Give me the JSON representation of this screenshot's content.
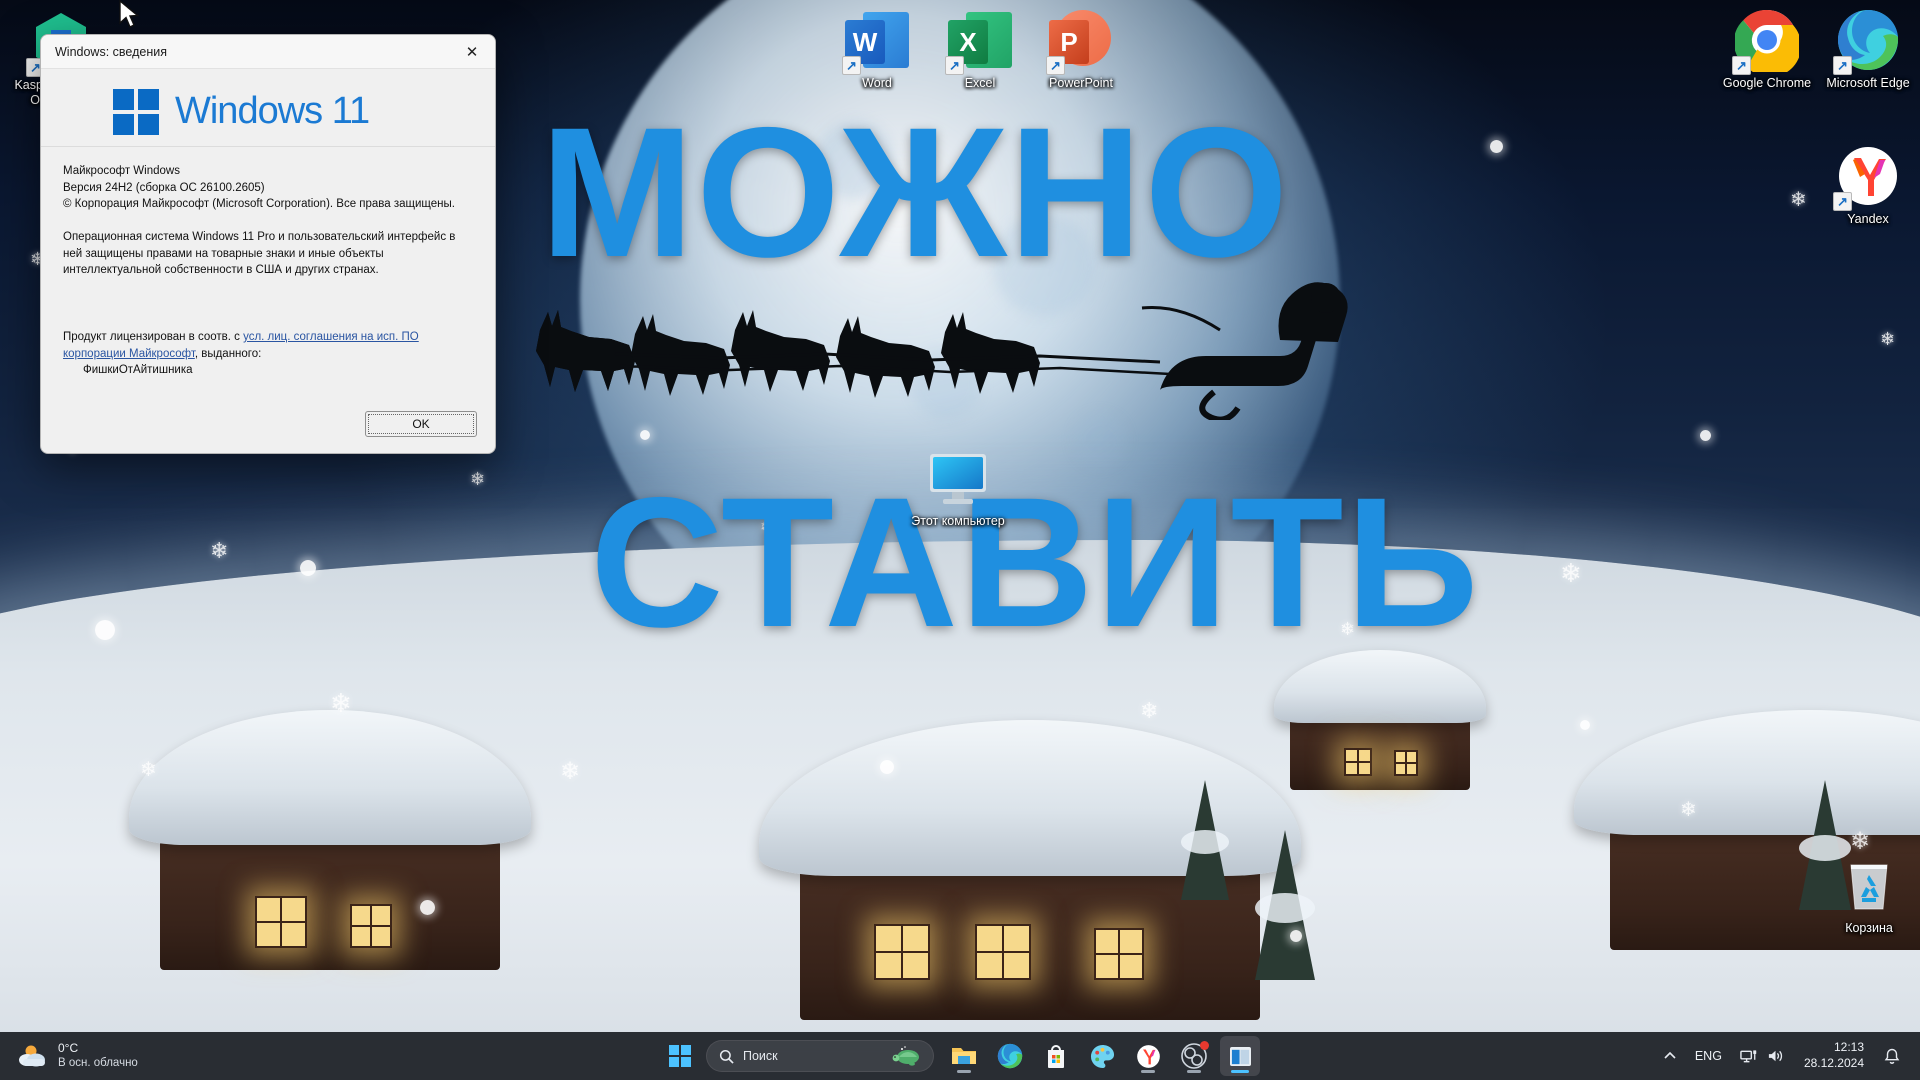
{
  "wallpaper": {
    "scene": "winter-night-village-moon",
    "overlay_text_line1": "МОЖНО",
    "overlay_text_line2": "СТАВИТЬ",
    "overlay_color": "#1f8fe0"
  },
  "dialog": {
    "title": "Windows: сведения",
    "close_label": "✕",
    "brand_name": "Windows 11",
    "line_product": "Майкрософт Windows",
    "line_version": "Версия 24H2 (сборка ОС 26100.2605)",
    "line_copyright": "© Корпорация Майкрософт (Microsoft Corporation). Все права защищены.",
    "line_legal": "Операционная система Windows 11 Pro и пользовательский интерфейс в ней защищены правами на товарные знаки и иные объекты интеллектуальной собственности в США и других странах.",
    "license_prefix": "Продукт лицензирован в соотв. с ",
    "license_link": "усл. лиц. соглашения на исп. ПО корпорации Майкрософт",
    "license_suffix": ", выданного:",
    "license_owner": "ФишкиОтАйтишника",
    "ok_label": "OK"
  },
  "desktop_icons": [
    {
      "id": "kaspersky",
      "label": "Kaspersky Small Office Se...",
      "shortcut": true
    },
    {
      "id": "word",
      "label": "Word",
      "shortcut": true
    },
    {
      "id": "excel",
      "label": "Excel",
      "shortcut": true
    },
    {
      "id": "powerpoint",
      "label": "PowerPoint",
      "shortcut": true
    },
    {
      "id": "chrome",
      "label": "Google Chrome",
      "shortcut": true
    },
    {
      "id": "edge",
      "label": "Microsoft Edge",
      "shortcut": true
    },
    {
      "id": "yandex",
      "label": "Yandex",
      "shortcut": true
    },
    {
      "id": "thispc",
      "label": "Этот компьютер",
      "shortcut": false
    },
    {
      "id": "recyclebin",
      "label": "Корзина",
      "shortcut": false
    }
  ],
  "taskbar": {
    "weather": {
      "temperature": "0°C",
      "condition": "В осн. облачно",
      "icon": "partly-cloudy-icon"
    },
    "search": {
      "placeholder": "Поиск",
      "icon": "search-icon"
    },
    "buttons": [
      {
        "id": "start",
        "name": "start-button",
        "icon": "windows-logo-icon",
        "running": false
      },
      {
        "id": "explorer",
        "name": "file-explorer-button",
        "icon": "folder-icon",
        "running": true
      },
      {
        "id": "edge",
        "name": "edge-button",
        "icon": "edge-icon",
        "running": false
      },
      {
        "id": "store",
        "name": "microsoft-store-button",
        "icon": "store-bag-icon",
        "running": false
      },
      {
        "id": "paint",
        "name": "paint-button",
        "icon": "palette-icon",
        "running": false
      },
      {
        "id": "yandex",
        "name": "yandex-browser-button",
        "icon": "yandex-icon",
        "running": true
      },
      {
        "id": "obs",
        "name": "obs-studio-button",
        "icon": "obs-icon",
        "running": true,
        "badge": true
      },
      {
        "id": "activewindow",
        "name": "winver-window-button",
        "icon": "window-icon",
        "running": true,
        "active": true
      }
    ],
    "tray": {
      "overflow": "chevron-up-icon",
      "language": "ENG",
      "network": "network-icon",
      "volume": "volume-icon",
      "time": "12:13",
      "date": "28.12.2024",
      "notifications": "bell-icon"
    }
  }
}
